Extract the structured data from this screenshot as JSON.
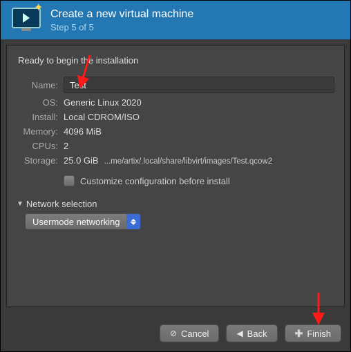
{
  "header": {
    "title": "Create a new virtual machine",
    "step": "Step 5 of 5"
  },
  "ready_text": "Ready to begin the installation",
  "fields": {
    "name_label": "Name:",
    "name_value": "Test",
    "os_label": "OS:",
    "os_value": "Generic Linux 2020",
    "install_label": "Install:",
    "install_value": "Local CDROM/ISO",
    "memory_label": "Memory:",
    "memory_value": "4096 MiB",
    "cpus_label": "CPUs:",
    "cpus_value": "2",
    "storage_label": "Storage:",
    "storage_value": "25.0 GiB",
    "storage_path": "...me/artix/.local/share/libvirt/images/Test.qcow2"
  },
  "customize_label": "Customize configuration before install",
  "network": {
    "section_label": "Network selection",
    "selected": "Usermode networking"
  },
  "buttons": {
    "cancel": "Cancel",
    "back": "Back",
    "finish": "Finish"
  }
}
